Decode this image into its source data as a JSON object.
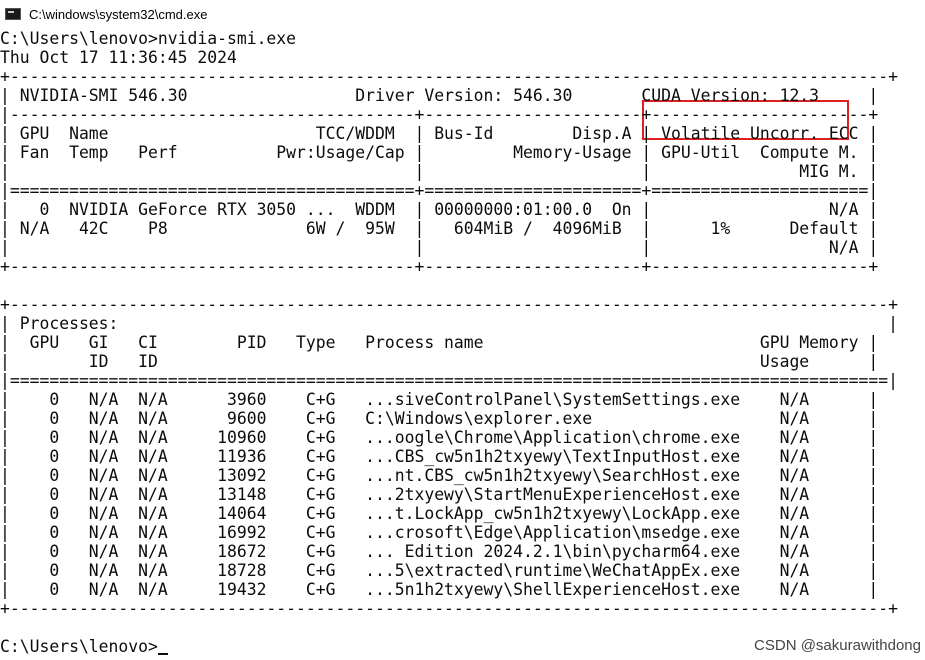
{
  "window": {
    "title": "C:\\windows\\system32\\cmd.exe"
  },
  "console": {
    "lines": [
      "C:\\Users\\lenovo>nvidia-smi.exe",
      "Thu Oct 17 11:36:45 2024",
      "+-----------------------------------------------------------------------------------------+",
      "| NVIDIA-SMI 546.30                 Driver Version: 546.30       CUDA Version: 12.3     |",
      "|-----------------------------------------+----------------------+----------------------+",
      "| GPU  Name                     TCC/WDDM  | Bus-Id        Disp.A | Volatile Uncorr. ECC |",
      "| Fan  Temp   Perf          Pwr:Usage/Cap |         Memory-Usage | GPU-Util  Compute M. |",
      "|                                         |                      |               MIG M. |",
      "|=========================================+======================+======================|",
      "|   0  NVIDIA GeForce RTX 3050 ...  WDDM  | 00000000:01:00.0  On |                  N/A |",
      "| N/A   42C    P8              6W /  95W  |   604MiB /  4096MiB  |      1%      Default |",
      "|                                         |                      |                  N/A |",
      "+-----------------------------------------+----------------------+----------------------+",
      "",
      "+-----------------------------------------------------------------------------------------+",
      "| Processes:                                                                              |",
      "|  GPU   GI   CI        PID   Type   Process name                            GPU Memory |",
      "|        ID   ID                                                             Usage      |",
      "|=========================================================================================|",
      "|    0   N/A  N/A      3960    C+G   ...siveControlPanel\\SystemSettings.exe    N/A      |",
      "|    0   N/A  N/A      9600    C+G   C:\\Windows\\explorer.exe                   N/A      |",
      "|    0   N/A  N/A     10960    C+G   ...oogle\\Chrome\\Application\\chrome.exe    N/A      |",
      "|    0   N/A  N/A     11936    C+G   ...CBS_cw5n1h2txyewy\\TextInputHost.exe    N/A      |",
      "|    0   N/A  N/A     13092    C+G   ...nt.CBS_cw5n1h2txyewy\\SearchHost.exe    N/A      |",
      "|    0   N/A  N/A     13148    C+G   ...2txyewy\\StartMenuExperienceHost.exe    N/A      |",
      "|    0   N/A  N/A     14064    C+G   ...t.LockApp_cw5n1h2txyewy\\LockApp.exe    N/A      |",
      "|    0   N/A  N/A     16992    C+G   ...crosoft\\Edge\\Application\\msedge.exe    N/A      |",
      "|    0   N/A  N/A     18672    C+G   ... Edition 2024.2.1\\bin\\pycharm64.exe    N/A      |",
      "|    0   N/A  N/A     18728    C+G   ...5\\extracted\\runtime\\WeChatAppEx.exe    N/A      |",
      "|    0   N/A  N/A     19432    C+G   ...5n1h2txyewy\\ShellExperienceHost.exe    N/A      |",
      "+-----------------------------------------------------------------------------------------+",
      "",
      "C:\\Users\\lenovo>"
    ]
  },
  "watermark": {
    "text": "CSDN @sakurawithdong"
  },
  "colors": {
    "background": "#ffffff",
    "text": "#0c0c0c",
    "highlight": "#e02020"
  }
}
